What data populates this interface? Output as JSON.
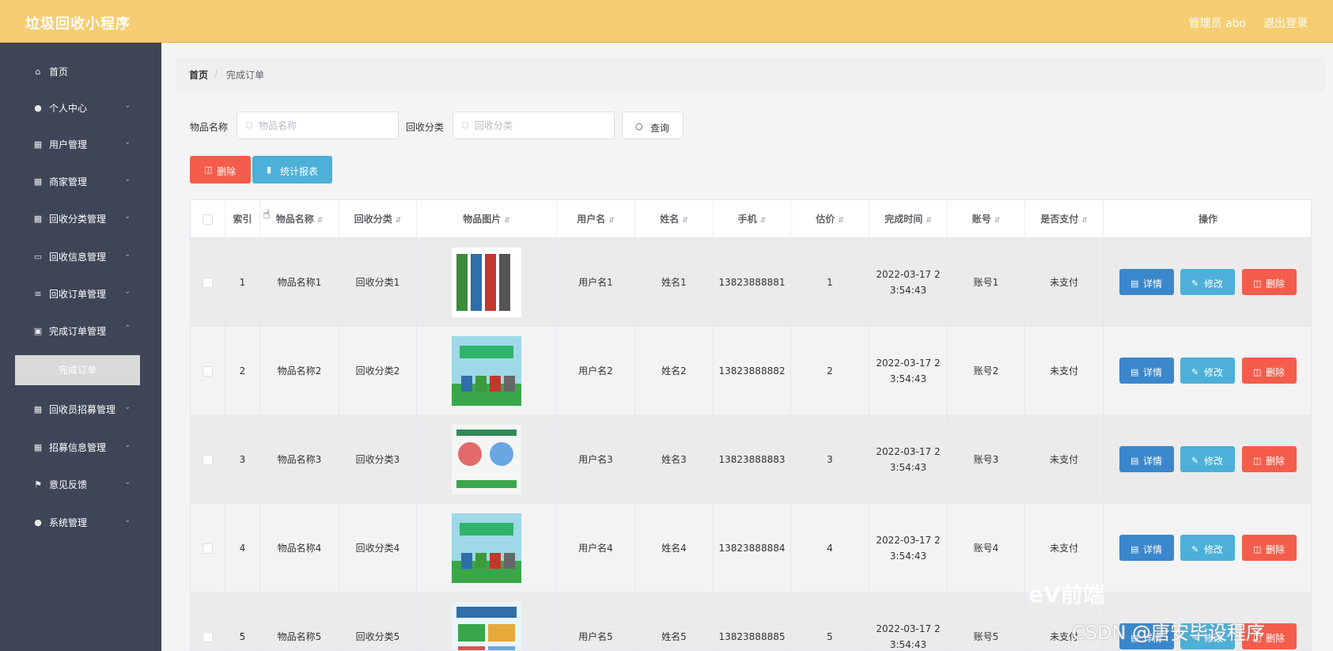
{
  "header": {
    "title": "垃圾回收小程序",
    "user": "管理员 abo",
    "logout": "退出登录"
  },
  "sidebar": {
    "items": [
      {
        "label": "首页",
        "icon": "home-icon"
      },
      {
        "label": "个人中心",
        "icon": "user-icon"
      },
      {
        "label": "用户管理",
        "icon": "grid-icon"
      },
      {
        "label": "商家管理",
        "icon": "grid-icon"
      },
      {
        "label": "回收分类管理",
        "icon": "grid-icon"
      },
      {
        "label": "回收信息管理",
        "icon": "monitor-icon"
      },
      {
        "label": "回收订单管理",
        "icon": "sliders-icon"
      },
      {
        "label": "完成订单管理",
        "icon": "clipboard-icon"
      },
      {
        "label": "回收员招募管理",
        "icon": "grid-icon"
      },
      {
        "label": "招募信息管理",
        "icon": "grid-icon"
      },
      {
        "label": "意见反馈",
        "icon": "flag-icon"
      },
      {
        "label": "系统管理",
        "icon": "user-icon"
      }
    ],
    "active_sub": "完成订单"
  },
  "breadcrumb": {
    "home": "首页",
    "sep": "/",
    "current": "完成订单"
  },
  "search": {
    "name_label": "物品名称",
    "name_placeholder": "物品名称",
    "category_label": "回收分类",
    "category_placeholder": "回收分类",
    "query": "查询"
  },
  "actions": {
    "delete": "删除",
    "report": "统计报表"
  },
  "table": {
    "headers": [
      "索引",
      "物品名称",
      "回收分类",
      "物品图片",
      "用户名",
      "姓名",
      "手机",
      "估价",
      "完成时间",
      "账号",
      "是否支付",
      "操作"
    ],
    "rows": [
      {
        "index": "1",
        "name": "物品名称1",
        "category": "回收分类1",
        "user": "用户名1",
        "realname": "姓名1",
        "phone": "13823888881",
        "price": "1",
        "time1": "2022-03-17 2",
        "time2": "3:54:43",
        "account": "账号1",
        "paid": "未支付"
      },
      {
        "index": "2",
        "name": "物品名称2",
        "category": "回收分类2",
        "user": "用户名2",
        "realname": "姓名2",
        "phone": "13823888882",
        "price": "2",
        "time1": "2022-03-17 2",
        "time2": "3:54:43",
        "account": "账号2",
        "paid": "未支付"
      },
      {
        "index": "3",
        "name": "物品名称3",
        "category": "回收分类3",
        "user": "用户名3",
        "realname": "姓名3",
        "phone": "13823888883",
        "price": "3",
        "time1": "2022-03-17 2",
        "time2": "3:54:43",
        "account": "账号3",
        "paid": "未支付"
      },
      {
        "index": "4",
        "name": "物品名称4",
        "category": "回收分类4",
        "user": "用户名4",
        "realname": "姓名4",
        "phone": "13823888884",
        "price": "4",
        "time1": "2022-03-17 2",
        "time2": "3:54:43",
        "account": "账号4",
        "paid": "未支付"
      },
      {
        "index": "5",
        "name": "物品名称5",
        "category": "回收分类5",
        "user": "用户名5",
        "realname": "姓名5",
        "phone": "13823888885",
        "price": "5",
        "time1": "2022-03-17 2",
        "time2": "3:54:43",
        "account": "账号5",
        "paid": "未支付"
      }
    ],
    "op": {
      "detail": "详情",
      "edit": "修改",
      "delete": "删除"
    }
  },
  "watermark": {
    "brand": "eV前端",
    "credit": "CSDN @唐安毕设程序"
  },
  "colors": {
    "header": "#f6cd72",
    "sidebar": "#3e4557",
    "danger": "#f45d4b",
    "info": "#4cb0d8",
    "primary": "#3b87cc"
  }
}
